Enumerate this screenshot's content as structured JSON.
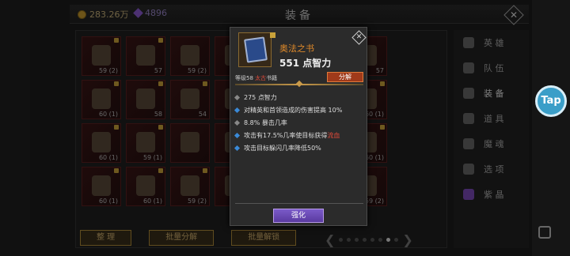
{
  "header": {
    "gold_value": "283.26万",
    "gem_value": "4896",
    "title": "装备",
    "close_glyph": "✕"
  },
  "grid": {
    "slots": [
      {
        "num": "59 (2)",
        "locked": true
      },
      {
        "num": "57",
        "locked": true
      },
      {
        "num": "59 (2)",
        "locked": false
      },
      {
        "num": "57",
        "locked": false
      },
      {
        "num": "",
        "locked": false
      },
      {
        "num": "57",
        "locked": false
      },
      {
        "num": "57",
        "locked": false
      },
      {
        "num": "60 (1)",
        "locked": true
      },
      {
        "num": "58",
        "locked": true
      },
      {
        "num": "54",
        "locked": true
      },
      {
        "num": "",
        "locked": false
      },
      {
        "num": "",
        "locked": false
      },
      {
        "num": "",
        "locked": true
      },
      {
        "num": "60 (1)",
        "locked": true
      },
      {
        "num": "60 (1)",
        "locked": true
      },
      {
        "num": "59 (1)",
        "locked": true
      },
      {
        "num": "",
        "locked": false
      },
      {
        "num": "",
        "locked": false
      },
      {
        "num": "",
        "locked": false
      },
      {
        "num": "59 (1)",
        "locked": false
      },
      {
        "num": "60 (1)",
        "locked": true
      },
      {
        "num": "60 (1)",
        "locked": true
      },
      {
        "num": "60 (1)",
        "locked": true
      },
      {
        "num": "59 (2)",
        "locked": true
      },
      {
        "num": "",
        "locked": false
      },
      {
        "num": "",
        "locked": false
      },
      {
        "num": "",
        "locked": false
      },
      {
        "num": "59 (2)",
        "locked": false
      }
    ]
  },
  "bottom": {
    "organize": "整 理",
    "batch_decompose": "批量分解",
    "batch_unlock": "批量解锁"
  },
  "sidebar": {
    "items": [
      {
        "label": "英 雄",
        "icon": "hero-icon"
      },
      {
        "label": "队 伍",
        "icon": "team-icon"
      },
      {
        "label": "装 备",
        "icon": "equipment-icon"
      },
      {
        "label": "道 具",
        "icon": "items-icon"
      },
      {
        "label": "魔 魂",
        "icon": "soul-icon"
      },
      {
        "label": "选 项",
        "icon": "options-icon"
      },
      {
        "label": "紫 晶",
        "icon": "amethyst-icon"
      }
    ]
  },
  "tap": {
    "label": "Tap"
  },
  "popup": {
    "item_name": "奥法之书",
    "main_stat": "551 点智力",
    "level_prefix": "等级58 ",
    "rarity": "太古",
    "type_suffix": "书籍",
    "decompose_label": "分解",
    "close_glyph": "✕",
    "stats": [
      {
        "text": "275 点智力",
        "bullet": "grey"
      },
      {
        "text": "对精英和首领造成的伤害提高 10%",
        "bullet": "blue"
      },
      {
        "text": "8.8% 暴击几率",
        "bullet": "grey"
      },
      {
        "text_before": "攻击有17.5%几率使目标获得",
        "highlight": "流血",
        "bullet": "blue"
      },
      {
        "text": "攻击目标躲闪几率降低50%",
        "bullet": "blue"
      }
    ],
    "enhance_label": "强化"
  },
  "colors": {
    "rarity_red": "#e04a3a",
    "item_name_orange": "#e08a2a",
    "enhance_purple": "#6a4ab8",
    "tap_blue": "#3a9ec8"
  }
}
